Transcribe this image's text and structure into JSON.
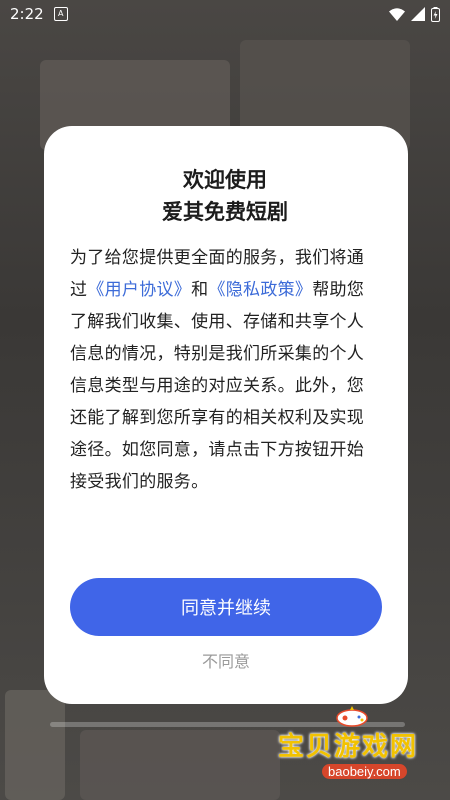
{
  "status_bar": {
    "time": "2:22",
    "notification_icon": "A",
    "icons": [
      "wifi-icon",
      "signal-icon",
      "battery-icon"
    ]
  },
  "dialog": {
    "title_line1": "欢迎使用",
    "title_line2": "爱其免费短剧",
    "body_part1": "为了给您提供更全面的服务，我们将通过",
    "user_agreement_link": "《用户协议》",
    "and_text": "和",
    "privacy_policy_link": "《隐私政策》",
    "body_part2": "帮助您了解我们收集、使用、存储和共享个人信息的情况，特别是我们所采集的个人信息类型与用途的对应关系。此外，您还能了解到您所享有的相关权利及实现途径。如您同意，请点击下方按钮开始接受我们的服务。",
    "agree_button_label": "同意并继续",
    "disagree_label": "不同意"
  },
  "watermark": {
    "text": "宝贝游戏网",
    "url": "baobeiy.com"
  },
  "colors": {
    "link": "#3c6bd8",
    "primary_button": "#4065e8",
    "disagree_text": "#9a9a9a",
    "watermark_text": "#f2c200"
  }
}
